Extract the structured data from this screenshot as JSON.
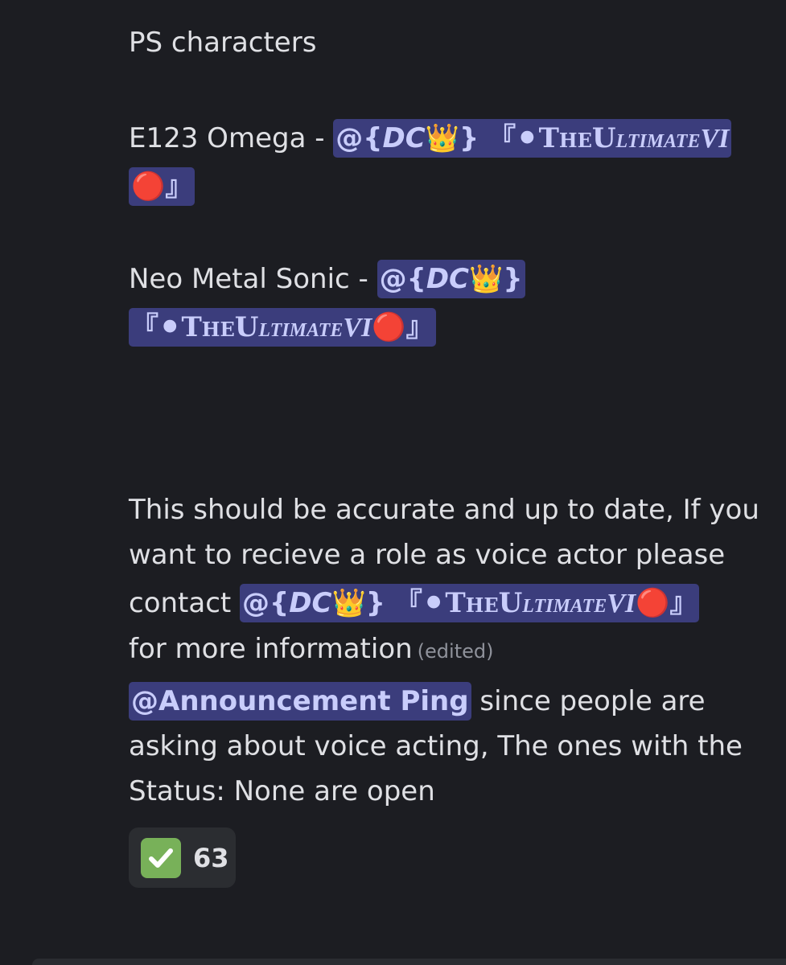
{
  "message": {
    "heading": "PS characters",
    "entries": [
      {
        "character_prefix": "E123 Omega - ",
        "mention": {
          "at": "@{",
          "dc": "DC",
          "crown": "👑",
          "close_brace": "}",
          "open_bracket": "『",
          "black_circle": "⚫",
          "name_1": "TheU",
          "name_2": "ltimate",
          "name_3": "VI",
          "red_circle": "🔴",
          "close_bracket": "』"
        }
      },
      {
        "character_prefix": "Neo Metal Sonic - ",
        "mention": {
          "at": "@{",
          "dc": "DC",
          "crown": "👑",
          "close_brace": "}",
          "open_bracket": "『",
          "black_circle": "⚫",
          "name_1": "TheU",
          "name_2": "ltimate",
          "name_3": "VI",
          "red_circle": "🔴",
          "close_bracket": "』"
        }
      }
    ],
    "info_line_1": "This should be accurate and up to date, If you",
    "info_line_2": "want to recieve a role as voice actor please",
    "info_line_3_prefix": "contact ",
    "contact_mention": {
      "at": "@{",
      "dc": "DC",
      "crown": "👑",
      "close_brace": "}",
      "open_bracket": "『",
      "black_circle": "⚫",
      "name_1": "TheU",
      "name_2": "ltimate",
      "name_3": "VI",
      "red_circle": "🔴",
      "close_bracket": "』"
    },
    "info_line_4": "for more information",
    "edited_label": "(edited)"
  },
  "second_message": {
    "role_mention": "@Announcement Ping",
    "line_1_suffix": " since people are",
    "line_2": "asking about voice acting, The ones with the",
    "line_3": "Status: None are open"
  },
  "reaction": {
    "emoji_icon": "white-check-mark-icon",
    "emoji_color": "#78b159",
    "count": "63"
  },
  "colors": {
    "background": "#1c1d22",
    "mention_bg": "#3b3d7c",
    "mention_text": "#c9cdfb",
    "reaction_bg": "#2b2d31"
  }
}
